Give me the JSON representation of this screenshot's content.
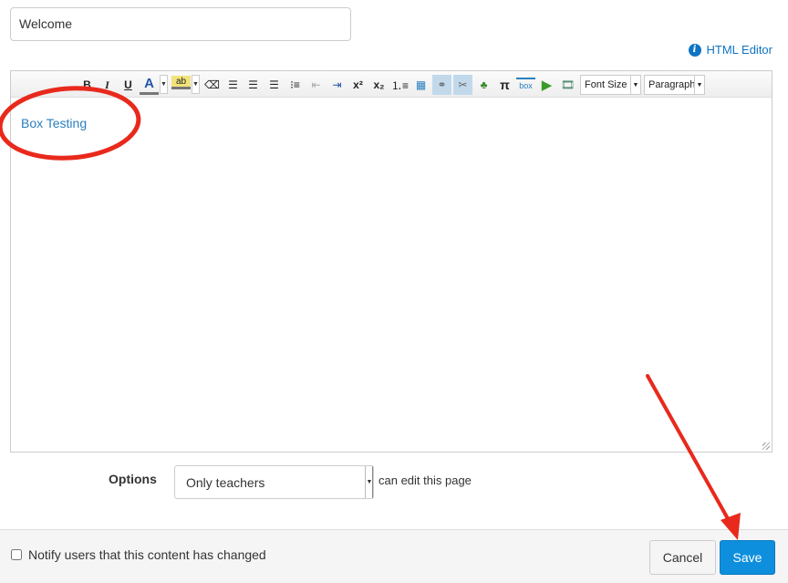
{
  "title_input": {
    "value": "Welcome"
  },
  "html_editor_link": "HTML Editor",
  "toolbar": {
    "bold": "B",
    "italic": "I",
    "underline": "U",
    "font_color": "A",
    "highlight": "ab",
    "superscript": "x²",
    "subscript": "x₂",
    "pi": "π",
    "box": "box",
    "font_size": "Font Size",
    "paragraph": "Paragraph"
  },
  "editor": {
    "content": "Box Testing"
  },
  "options": {
    "label": "Options",
    "selected": "Only teachers",
    "suffix": "can edit this page"
  },
  "footer": {
    "notify_label": "Notify users that this content has changed",
    "notify_checked": false,
    "cancel": "Cancel",
    "save": "Save"
  },
  "annotation_color": "#e8291c",
  "accent_color": "#0e8fdd"
}
